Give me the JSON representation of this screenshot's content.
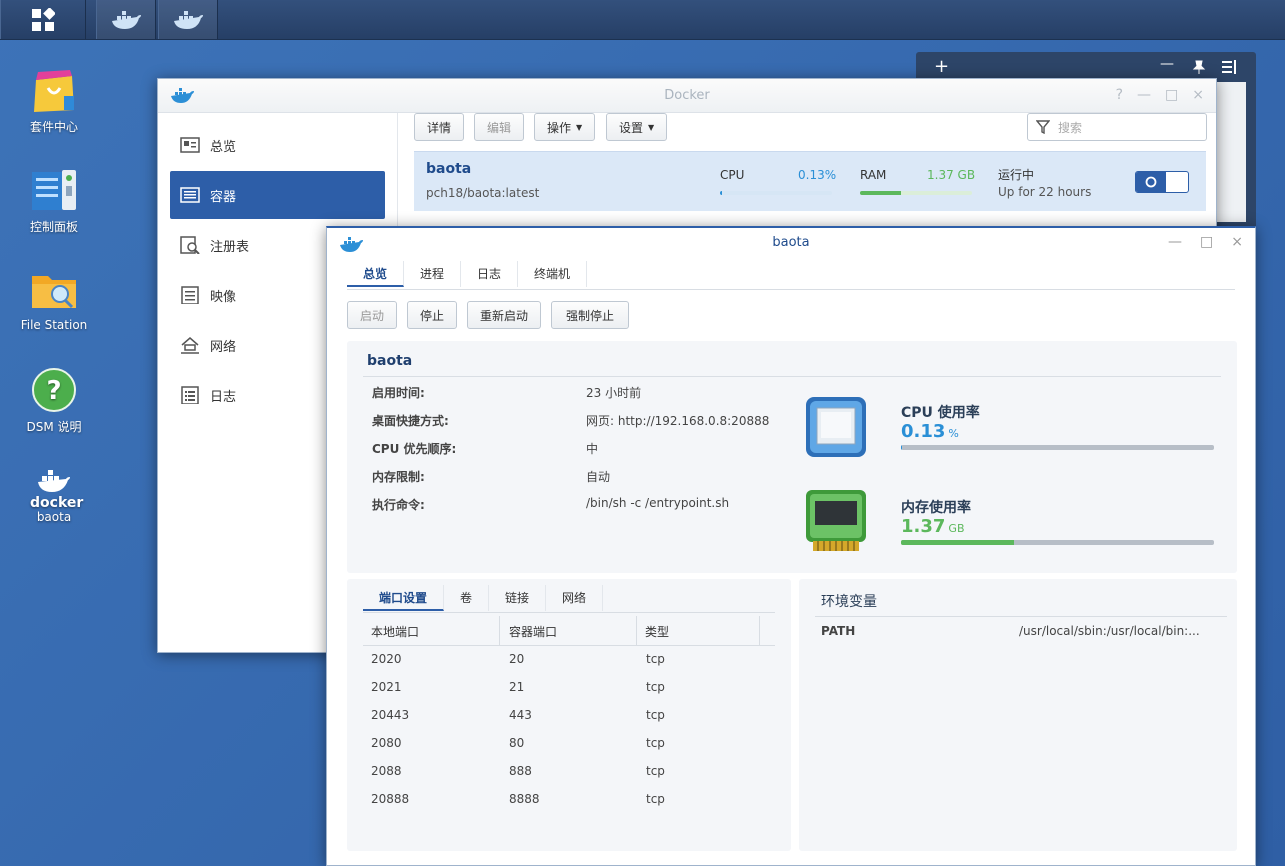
{
  "desktop": {
    "icons": [
      {
        "label": "套件中心",
        "icon": "package-center-icon"
      },
      {
        "label": "控制面板",
        "icon": "control-panel-icon"
      },
      {
        "label": "File Station",
        "icon": "file-station-icon"
      },
      {
        "label": "DSM 说明",
        "icon": "help-icon"
      },
      {
        "label": "baota",
        "icon": "docker-icon",
        "sublabel": "docker"
      }
    ]
  },
  "taskbar": {
    "main_icon": "main-menu-icon",
    "apps": [
      "docker-icon",
      "docker-icon"
    ]
  },
  "docker_window": {
    "title": "Docker",
    "controls": [
      "?",
      "—",
      "□",
      "×"
    ],
    "sidebar": [
      "总览",
      "容器",
      "注册表",
      "映像",
      "网络",
      "日志"
    ],
    "active_index": 1,
    "toolbar": {
      "details": "详情",
      "edit": "编辑",
      "action": "操作",
      "settings": "设置",
      "search_placeholder": "搜索"
    },
    "container": {
      "name": "baota",
      "image": "pch18/baota:latest",
      "cpu_label": "CPU",
      "cpu_value": "0.13%",
      "cpu_fraction": 0.0013,
      "ram_label": "RAM",
      "ram_value": "1.37 GB",
      "ram_fraction": 0.37,
      "status": "运行中",
      "uptime": "Up for 22 hours",
      "toggle_on": true
    }
  },
  "baota_window": {
    "title": "baota",
    "controls": [
      "—",
      "□",
      "×"
    ],
    "tabs": [
      "总览",
      "进程",
      "日志",
      "终端机"
    ],
    "active_tab": 0,
    "buttons": {
      "start": "启动",
      "stop": "停止",
      "restart": "重新启动",
      "force_stop": "强制停止"
    },
    "info": {
      "name": "baota",
      "rows": [
        {
          "label": "启用时间:",
          "value": "23 小时前"
        },
        {
          "label": "桌面快捷方式:",
          "value": "网页: http://192.168.0.8:20888"
        },
        {
          "label": "CPU 优先顺序:",
          "value": "中"
        },
        {
          "label": "内存限制:",
          "value": "自动"
        },
        {
          "label": "执行命令:",
          "value": "/bin/sh -c /entrypoint.sh"
        }
      ],
      "cpu": {
        "label": "CPU 使用率",
        "value": "0.13",
        "unit": "%",
        "fraction": 0.0013,
        "color": "#2a8fd6"
      },
      "mem": {
        "label": "内存使用率",
        "value": "1.37",
        "unit": "GB",
        "fraction": 0.36,
        "color": "#5cb85c"
      }
    },
    "port_tabs": [
      "端口设置",
      "卷",
      "链接",
      "网络"
    ],
    "port_headers": [
      "本地端口",
      "容器端口",
      "类型"
    ],
    "ports": [
      [
        "2020",
        "20",
        "tcp"
      ],
      [
        "2021",
        "21",
        "tcp"
      ],
      [
        "20443",
        "443",
        "tcp"
      ],
      [
        "2080",
        "80",
        "tcp"
      ],
      [
        "2088",
        "888",
        "tcp"
      ],
      [
        "20888",
        "8888",
        "tcp"
      ]
    ],
    "env": {
      "title": "环境变量",
      "rows": [
        {
          "key": "PATH",
          "value": "/usr/local/sbin:/usr/local/bin:..."
        }
      ]
    }
  },
  "widget": {
    "controls": [
      "+",
      "—",
      "pin",
      "menu"
    ]
  }
}
